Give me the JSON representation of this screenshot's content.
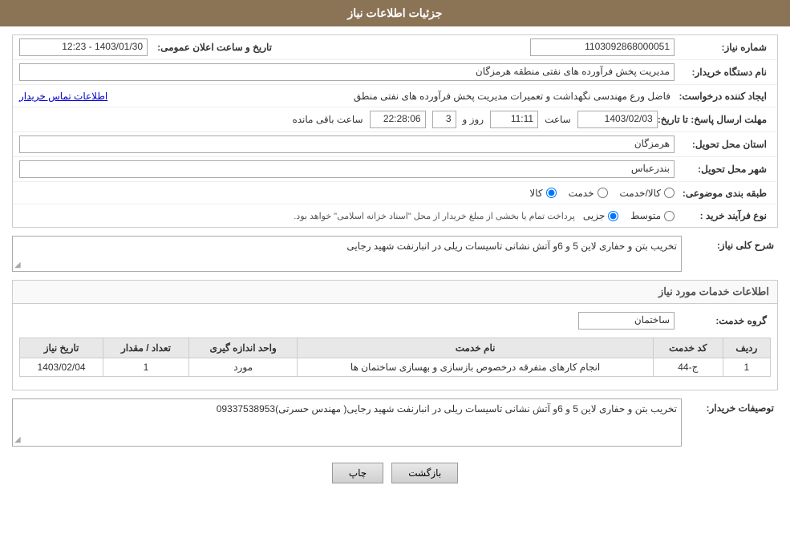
{
  "page": {
    "title": "جزئیات اطلاعات نیاز",
    "header_bg": "#8B7355"
  },
  "fields": {
    "shomara_niaz_label": "شماره نیاز:",
    "shomara_niaz_value": "1103092868000051",
    "nam_dastgah_label": "نام دستگاه خریدار:",
    "nam_dastgah_value": "مدیریت پخش فرآورده های نفتی منطقه هرمزگان",
    "ejad_konande_label": "ایجاد کننده درخواست:",
    "ejad_konande_value": "فاضل ورع مهندسی نگهداشت و تعمیرات مدیریت پخش فرآورده های نفتی منطق",
    "ejad_konande_link": "اطلاعات تماس خریدار",
    "mohlet_ersal_label": "مهلت ارسال پاسخ: تا تاریخ:",
    "tarikh_value": "1403/02/03",
    "saat_label": "ساعت",
    "saat_value": "11:11",
    "rooz_label": "روز و",
    "rooz_value": "3",
    "baqi_mande_label": "ساعت باقی مانده",
    "baqi_mande_value": "22:28:06",
    "ostan_label": "استان محل تحویل:",
    "ostan_value": "هرمزگان",
    "shahr_label": "شهر محل تحویل:",
    "shahr_value": "بندرعباس",
    "tabaqa_label": "طبقه بندی موضوعی:",
    "tarikh_ersal_label": "تاریخ و ساعت اعلان عمومی:",
    "tarikh_ersal_value": "1403/01/30 - 12:23",
    "nooe_farayand_label": "نوع فرآیند خرید :",
    "nooe_farayand_text": "پرداخت تمام یا بخشی از مبلغ خریدار از محل \"اسناد خزانه اسلامی\" خواهد بود.",
    "sharh_label": "شرح کلی نیاز:",
    "sharh_value": "تخریب بتن و حفاری لاین 5 و 6و آتش نشانی تاسیسات ریلی در انبارنفت شهید رجایی",
    "khadamat_label": "اطلاعات خدمات مورد نیاز",
    "group_khadamat_label": "گروه خدمت:",
    "group_khadamat_value": "ساختمان",
    "table": {
      "headers": [
        "ردیف",
        "کد خدمت",
        "نام خدمت",
        "واحد اندازه گیری",
        "تعداد / مقدار",
        "تاریخ نیاز"
      ],
      "rows": [
        {
          "radif": "1",
          "kod_khadamat": "ج-44",
          "nam_khadamat": "انجام کارهای متفرقه درخصوص بازسازی و بهسازی ساختمان ها",
          "vahed": "مورد",
          "tedad": "1",
          "tarikh": "1403/02/04"
        }
      ]
    },
    "tosaif_label": "توصیفات خریدار:",
    "tosaif_value": "تخریب بتن و حفاری لاین 5 و 6و آتش نشانی تاسیسات ریلی در انبارنفت شهید رجایی( مهندس حسرتی)09337538953",
    "tabaqa_options": [
      {
        "label": "کالا",
        "value": "kala"
      },
      {
        "label": "خدمت",
        "value": "khadamat"
      },
      {
        "label": "کالا/خدمت",
        "value": "kala_khadamat"
      }
    ],
    "nooe_options": [
      {
        "label": "جزیی",
        "value": "jozi"
      },
      {
        "label": "متوسط",
        "value": "motovaset"
      }
    ],
    "btn_print": "چاپ",
    "btn_back": "بازگشت"
  }
}
